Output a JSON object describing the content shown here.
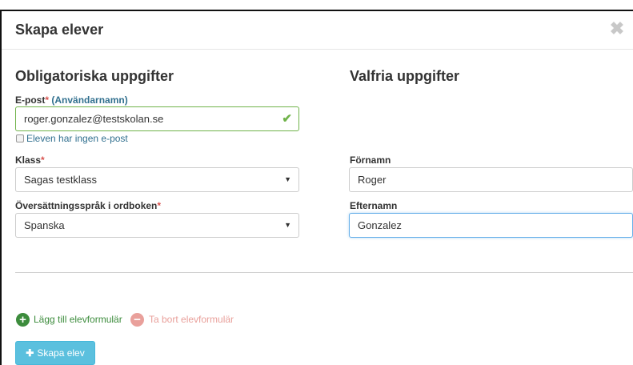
{
  "modal": {
    "title": "Skapa elever",
    "close_glyph": "✖"
  },
  "left": {
    "title": "Obligatoriska uppgifter",
    "email": {
      "label": "E-post",
      "required_mark": "*",
      "hint": "(Användarnamn)",
      "value": "roger.gonzalez@testskolan.se",
      "valid_icon": "check-icon"
    },
    "no_email_checkbox": {
      "label": "Eleven har ingen e-post",
      "checked": false
    },
    "class": {
      "label": "Klass",
      "required_mark": "*",
      "selected": "Sagas testklass"
    },
    "language": {
      "label": "Översättningsspråk i ordboken",
      "required_mark": "*",
      "selected": "Spanska"
    }
  },
  "right": {
    "title": "Valfria uppgifter",
    "first_name": {
      "label": "Förnamn",
      "value": "Roger"
    },
    "last_name": {
      "label": "Efternamn",
      "value": "Gonzalez"
    }
  },
  "actions": {
    "add_form": "Lägg till elevformulär",
    "remove_form": "Ta bort elevformulär",
    "submit": "Skapa elev"
  },
  "colors": {
    "accent": "#5bc0de",
    "success": "#70b34a",
    "required": "#d9534f",
    "link": "#31708f",
    "danger_light": "#e9a09b"
  }
}
